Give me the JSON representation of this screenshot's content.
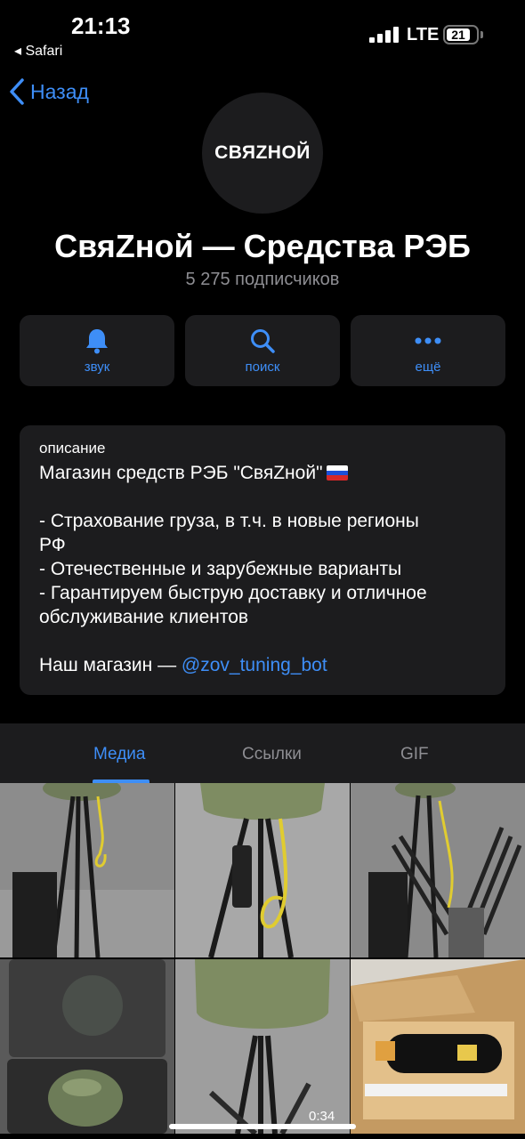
{
  "status_bar": {
    "time": "21:13",
    "back_app": "◂ Safari",
    "network": "LTE",
    "battery": "21"
  },
  "nav": {
    "back_label": "Назад"
  },
  "channel": {
    "logo_text": "СВЯZНОЙ",
    "title": "СвяZной — Средства РЭБ",
    "subscribers": "5 275 подписчиков"
  },
  "actions": [
    {
      "label": "звук",
      "icon": "bell-icon"
    },
    {
      "label": "поиск",
      "icon": "search-icon"
    },
    {
      "label": "ещё",
      "icon": "more-icon"
    }
  ],
  "description": {
    "label": "описание",
    "line1": "Магазин средств РЭБ \"СвяZной\"",
    "line2": "- Страхование груза, в т.ч. в новые регионы",
    "line3": "РФ",
    "line4": "- Отечественные и зарубежные варианты",
    "line5": "- Гарантируем быструю доставку и отличное",
    "line6": "обслуживание клиентов",
    "shop_prefix": "Наш магазин — ",
    "shop_link": "@zov_tuning_bot"
  },
  "tabs": [
    {
      "label": "Медиа",
      "active": true
    },
    {
      "label": "Ссылки",
      "active": false
    },
    {
      "label": "GIF",
      "active": false
    }
  ],
  "media": {
    "video_duration": "0:34"
  },
  "colors": {
    "accent": "#3e8ef7",
    "card": "#1c1c1e",
    "background": "#000000",
    "secondary_text": "#8e8e93"
  }
}
